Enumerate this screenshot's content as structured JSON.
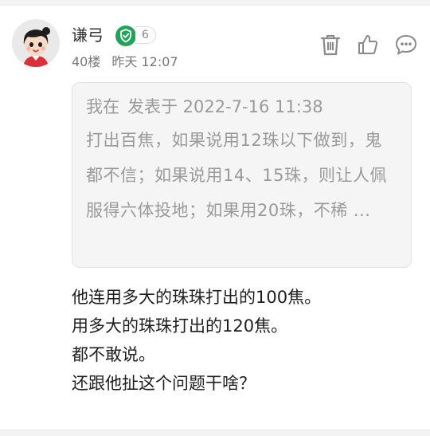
{
  "comment": {
    "username": "谦弓",
    "level": "6",
    "floor": "40楼",
    "time": "昨天 12:07",
    "quote": {
      "author": "我在",
      "posted_at": "发表于 2022-7-16 11:38",
      "text": "打出百焦，如果说用12珠以下做到，鬼都不信；如果说用14、15珠，则让人佩服得六体投地；如果用20珠，不稀 ..."
    },
    "lines": [
      "他连用多大的珠珠打出的100焦。",
      "用多大的珠珠打出的120焦。",
      "都不敢说。",
      "还跟他扯这个问题干啥？"
    ]
  },
  "icons": {
    "avatar": "cartoon-girl-avatar",
    "verified": "shield-check-icon",
    "delete": "trash-icon",
    "like": "thumbs-up-icon",
    "comment": "chat-bubble-icon"
  },
  "colors": {
    "verified_green": "#22a35a",
    "icon_gray": "#8a8a8a",
    "quote_bg": "#f5f5f5"
  }
}
